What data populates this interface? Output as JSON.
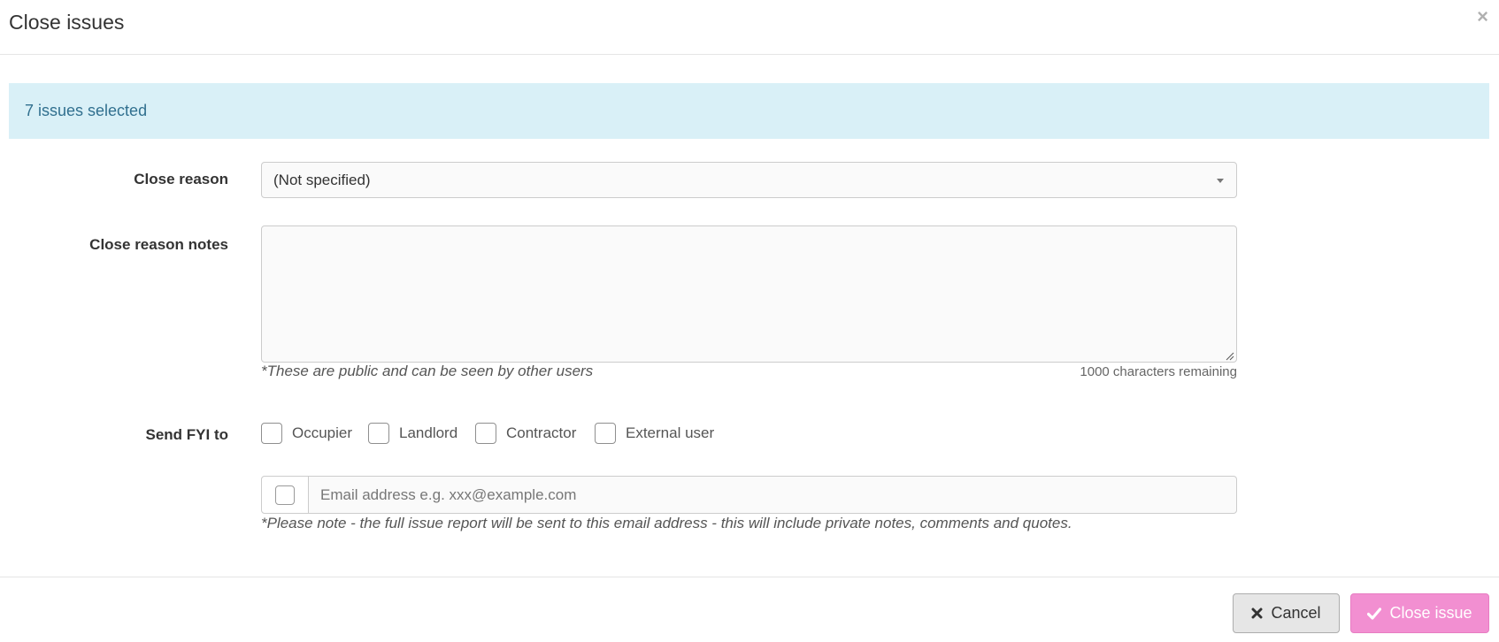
{
  "modal": {
    "title": "Close issues",
    "close_icon": "times-icon"
  },
  "alert": {
    "text": "7 issues selected",
    "color": "#31708f",
    "background": "#d9f0f7"
  },
  "form": {
    "close_reason": {
      "label": "Close reason",
      "selected": "(Not specified)"
    },
    "close_reason_notes": {
      "label": "Close reason notes",
      "value": "",
      "help": "*These are public and can be seen by other users",
      "remaining": "1000 characters remaining"
    },
    "send_fyi": {
      "label": "Send FYI to",
      "options": [
        {
          "label": "Occupier",
          "checked": false
        },
        {
          "label": "Landlord",
          "checked": false
        },
        {
          "label": "Contractor",
          "checked": false
        },
        {
          "label": "External user",
          "checked": false
        }
      ]
    },
    "email": {
      "placeholder": "Email address e.g. xxx@example.com",
      "value": "",
      "checked": false,
      "note": "*Please note - the full issue report will be sent to this email address - this will include private notes, comments and quotes."
    }
  },
  "footer": {
    "cancel_label": "Cancel",
    "cancel_icon": "times-icon",
    "close_label": "Close issue",
    "close_icon": "check-icon",
    "close_color": "#f28fd1"
  }
}
